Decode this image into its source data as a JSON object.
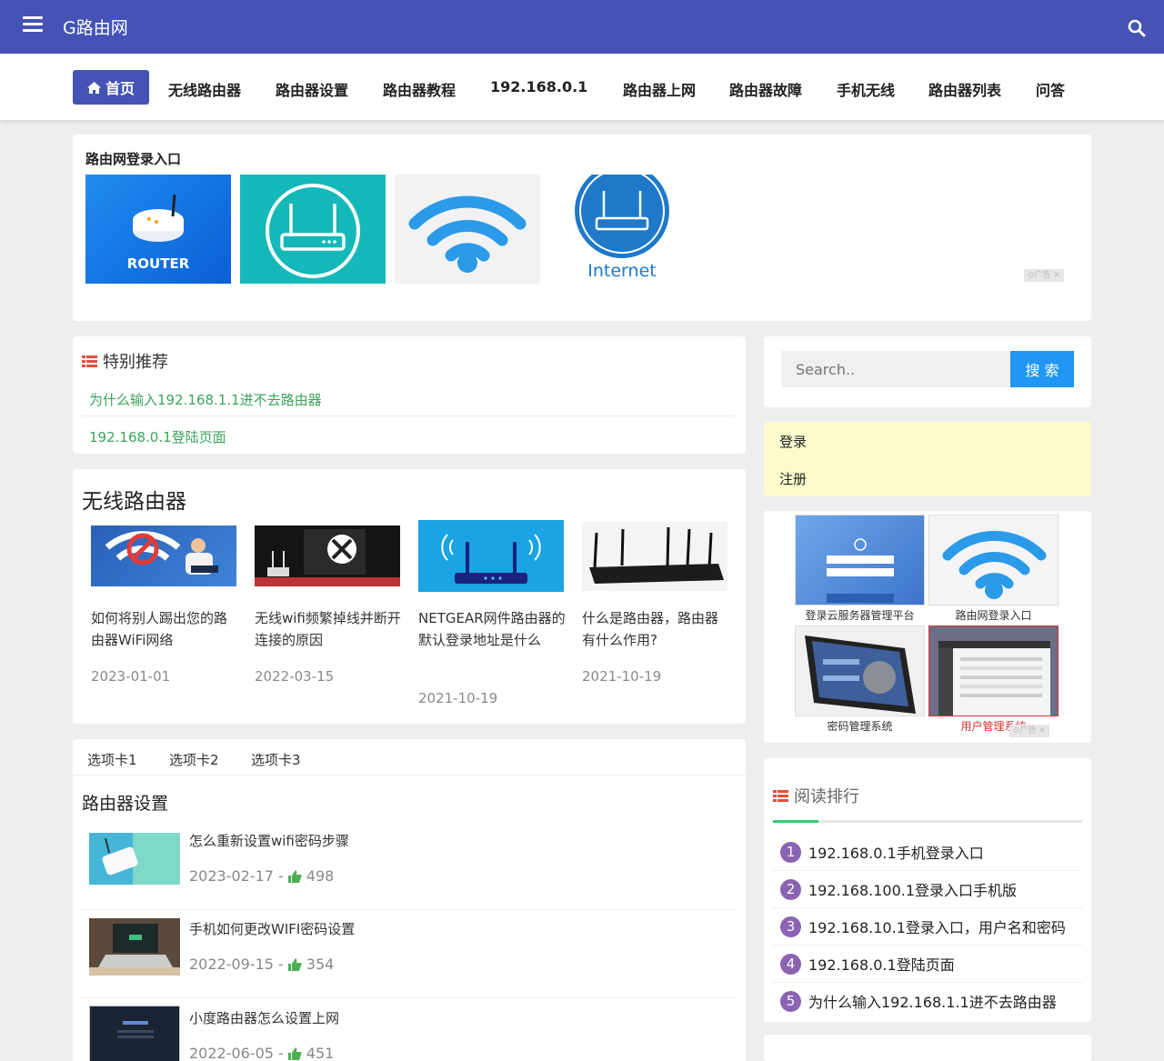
{
  "header": {
    "site_title": "G路由网",
    "menu_icon": "hamburger-icon",
    "search_icon": "search-icon",
    "bg_color": "#4553b6"
  },
  "nav": {
    "home": "首页",
    "items": [
      "无线路由器",
      "路由器设置",
      "路由器教程",
      "192.168.0.1",
      "路由器上网",
      "路由器故障",
      "手机无线",
      "路由器列表",
      "问答"
    ]
  },
  "banner": {
    "title": "路由网登录入口",
    "thumb1_text": "ROUTER",
    "thumb4_text": "Internet",
    "ad_label": "广告"
  },
  "featured": {
    "title": "特别推荐",
    "links": [
      "为什么输入192.168.1.1进不去路由器",
      "192.168.0.1登陆页面"
    ]
  },
  "wireless": {
    "title": "无线路由器",
    "items": [
      {
        "title": "如何将别人踢出您的路由器WiFi网络",
        "date": "2023-01-01"
      },
      {
        "title": "无线wifi频繁掉线并断开连接的原因",
        "date": "2022-03-15"
      },
      {
        "title": "NETGEAR网件路由器的默认登录地址是什么",
        "date": "2021-10-19"
      },
      {
        "title": "什么是路由器，路由器有什么作用?",
        "date": "2021-10-19"
      }
    ]
  },
  "tabs": {
    "labels": [
      "选项卡1",
      "选项卡2",
      "选项卡3"
    ],
    "section_title": "路由器设置",
    "articles": [
      {
        "title": "怎么重新设置wifi密码步骤",
        "date": "2023-02-17",
        "sep": "-",
        "likes": "498"
      },
      {
        "title": "手机如何更改WIFI密码设置",
        "date": "2022-09-15",
        "sep": "-",
        "likes": "354"
      },
      {
        "title": "小度路由器怎么设置上网",
        "date": "2022-06-05",
        "sep": "-",
        "likes": "451"
      }
    ]
  },
  "sidebar": {
    "search_placeholder": "Search..",
    "search_button": "搜 索",
    "login": "登录",
    "register": "注册",
    "ad_grid": [
      {
        "caption": "登录云服务器管理平台"
      },
      {
        "caption": "路由网登录入口"
      },
      {
        "caption": "密码管理系统"
      },
      {
        "caption": "用户管理系统"
      }
    ],
    "ad_label": "广告",
    "rank_title": "阅读排行",
    "rank": [
      {
        "num": "1",
        "title": "192.168.0.1手机登录入口"
      },
      {
        "num": "2",
        "title": "192.168.100.1登录入口手机版"
      },
      {
        "num": "3",
        "title": "192.168.10.1登录入口，用户名和密码"
      },
      {
        "num": "4",
        "title": "192.168.0.1登陆页面"
      },
      {
        "num": "5",
        "title": "为什么输入192.168.1.1进不去路由器"
      }
    ]
  }
}
